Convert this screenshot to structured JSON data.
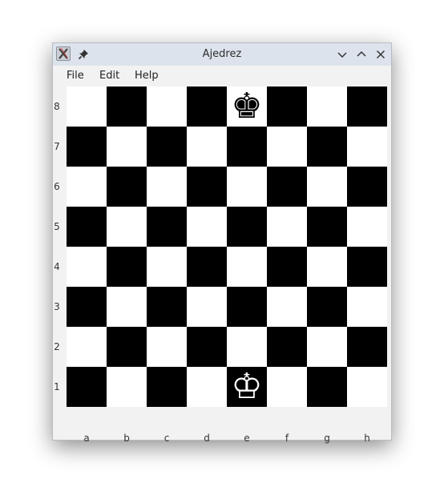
{
  "window": {
    "title": "Ajedrez",
    "app_icon": "app-x-icon",
    "pin_icon": "pin-icon",
    "controls": [
      "minimize-icon",
      "maximize-icon",
      "close-icon"
    ]
  },
  "menu": [
    {
      "label": "File"
    },
    {
      "label": "Edit"
    },
    {
      "label": "Help"
    }
  ],
  "board": {
    "ranks": [
      "8",
      "7",
      "6",
      "5",
      "4",
      "3",
      "2",
      "1"
    ],
    "files": [
      "a",
      "b",
      "c",
      "d",
      "e",
      "f",
      "g",
      "h"
    ],
    "light_color": "#ffffff",
    "dark_color": "#000000",
    "pieces": [
      {
        "square": "e8",
        "piece": "king",
        "color": "black",
        "glyph": "♚"
      },
      {
        "square": "e1",
        "piece": "king",
        "color": "white",
        "glyph": "♔"
      }
    ]
  }
}
